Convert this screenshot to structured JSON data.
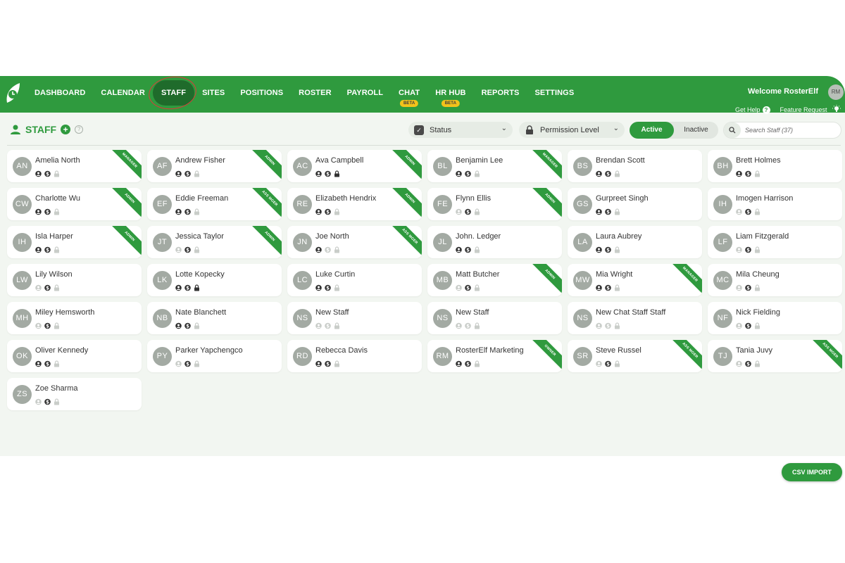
{
  "nav": {
    "items": [
      {
        "label": "DASHBOARD"
      },
      {
        "label": "CALENDAR"
      },
      {
        "label": "STAFF",
        "active": true
      },
      {
        "label": "SITES"
      },
      {
        "label": "POSITIONS"
      },
      {
        "label": "ROSTER"
      },
      {
        "label": "PAYROLL"
      },
      {
        "label": "CHAT",
        "badge": "BETA"
      },
      {
        "label": "HR HUB",
        "badge": "BETA"
      },
      {
        "label": "REPORTS"
      },
      {
        "label": "SETTINGS"
      }
    ],
    "welcome": "Welcome RosterElf",
    "user_initials": "RM",
    "get_help": "Get Help",
    "feature_request": "Feature Request"
  },
  "toolbar": {
    "title": "STAFF",
    "status_select": "Status",
    "permission_select": "Permission Level",
    "active_label": "Active",
    "inactive_label": "Inactive",
    "search_placeholder": "Search Staff (37)"
  },
  "staff": [
    {
      "initials": "AN",
      "name": "Amelia North",
      "ribbon": "MANAGER",
      "icons": [
        "dark",
        "dark",
        "light"
      ]
    },
    {
      "initials": "AF",
      "name": "Andrew Fisher",
      "ribbon": "ADMIN",
      "icons": [
        "dark",
        "dark",
        "light"
      ]
    },
    {
      "initials": "AC",
      "name": "Ava Campbell",
      "ribbon": "ADMIN",
      "icons": [
        "dark",
        "dark",
        "dark"
      ]
    },
    {
      "initials": "BL",
      "name": "Benjamin Lee",
      "ribbon": "MANAGER",
      "icons": [
        "dark",
        "dark",
        "light"
      ]
    },
    {
      "initials": "BS",
      "name": "Brendan Scott",
      "ribbon": "",
      "icons": [
        "dark",
        "dark",
        "light"
      ]
    },
    {
      "initials": "BH",
      "name": "Brett Holmes",
      "ribbon": "",
      "icons": [
        "dark",
        "dark",
        "light"
      ]
    },
    {
      "initials": "CW",
      "name": "Charlotte Wu",
      "ribbon": "ADMIN",
      "icons": [
        "dark",
        "dark",
        "light"
      ]
    },
    {
      "initials": "EF",
      "name": "Eddie Freeman",
      "ribbon": "ASS MGER",
      "icons": [
        "dark",
        "dark",
        "light"
      ]
    },
    {
      "initials": "RE",
      "name": "Elizabeth Hendrix",
      "ribbon": "ADMIN",
      "icons": [
        "dark",
        "dark",
        "light"
      ]
    },
    {
      "initials": "FE",
      "name": "Flynn Ellis",
      "ribbon": "ADMIN",
      "icons": [
        "light",
        "dark",
        "light"
      ]
    },
    {
      "initials": "GS",
      "name": "Gurpreet Singh",
      "ribbon": "",
      "icons": [
        "dark",
        "dark",
        "light"
      ]
    },
    {
      "initials": "IH",
      "name": "Imogen Harrison",
      "ribbon": "",
      "icons": [
        "light",
        "dark",
        "light"
      ]
    },
    {
      "initials": "IH",
      "name": "Isla Harper",
      "ribbon": "ADMIN",
      "icons": [
        "dark",
        "dark",
        "light"
      ]
    },
    {
      "initials": "JT",
      "name": "Jessica Taylor",
      "ribbon": "ADMIN",
      "icons": [
        "light",
        "dark",
        "light"
      ]
    },
    {
      "initials": "JN",
      "name": "Joe North",
      "ribbon": "ASS MGER",
      "icons": [
        "dark",
        "light",
        "light"
      ]
    },
    {
      "initials": "JL",
      "name": "John. Ledger",
      "ribbon": "",
      "icons": [
        "dark",
        "dark",
        "light"
      ]
    },
    {
      "initials": "LA",
      "name": "Laura Aubrey",
      "ribbon": "",
      "icons": [
        "dark",
        "dark",
        "light"
      ]
    },
    {
      "initials": "LF",
      "name": "Liam Fitzgerald",
      "ribbon": "",
      "icons": [
        "light",
        "dark",
        "light"
      ]
    },
    {
      "initials": "LW",
      "name": "Lily Wilson",
      "ribbon": "",
      "icons": [
        "light",
        "dark",
        "light"
      ]
    },
    {
      "initials": "LK",
      "name": "Lotte Kopecky",
      "ribbon": "",
      "icons": [
        "dark",
        "dark",
        "dark"
      ]
    },
    {
      "initials": "LC",
      "name": "Luke Curtin",
      "ribbon": "",
      "icons": [
        "dark",
        "dark",
        "light"
      ]
    },
    {
      "initials": "MB",
      "name": "Matt Butcher",
      "ribbon": "ADMIN",
      "icons": [
        "light",
        "dark",
        "light"
      ]
    },
    {
      "initials": "MW",
      "name": "Mia Wright",
      "ribbon": "MANAGER",
      "icons": [
        "dark",
        "dark",
        "light"
      ]
    },
    {
      "initials": "MC",
      "name": "Mila Cheung",
      "ribbon": "",
      "icons": [
        "light",
        "dark",
        "light"
      ]
    },
    {
      "initials": "MH",
      "name": "Miley Hemsworth",
      "ribbon": "",
      "icons": [
        "light",
        "dark",
        "light"
      ]
    },
    {
      "initials": "NB",
      "name": "Nate Blanchett",
      "ribbon": "",
      "icons": [
        "dark",
        "dark",
        "light"
      ]
    },
    {
      "initials": "NS",
      "name": "New Staff",
      "ribbon": "",
      "icons": [
        "light",
        "light",
        "light"
      ]
    },
    {
      "initials": "NS",
      "name": "New Staff",
      "ribbon": "",
      "icons": [
        "light",
        "light",
        "light"
      ]
    },
    {
      "initials": "NS",
      "name": "New Chat Staff Staff",
      "ribbon": "",
      "icons": [
        "light",
        "light",
        "light"
      ]
    },
    {
      "initials": "NF",
      "name": "Nick Fielding",
      "ribbon": "",
      "icons": [
        "light",
        "dark",
        "light"
      ]
    },
    {
      "initials": "OK",
      "name": "Oliver Kennedy",
      "ribbon": "",
      "icons": [
        "dark",
        "dark",
        "light"
      ]
    },
    {
      "initials": "PY",
      "name": "Parker Yapchengco",
      "ribbon": "",
      "icons": [
        "light",
        "dark",
        "light"
      ]
    },
    {
      "initials": "RD",
      "name": "Rebecca Davis",
      "ribbon": "",
      "icons": [
        "dark",
        "dark",
        "light"
      ]
    },
    {
      "initials": "RM",
      "name": "RosterElf Marketing",
      "ribbon": "OWNER",
      "icons": [
        "dark",
        "dark",
        "light"
      ]
    },
    {
      "initials": "SR",
      "name": "Steve Russel",
      "ribbon": "ASS MGER",
      "icons": [
        "light",
        "dark",
        "light"
      ]
    },
    {
      "initials": "TJ",
      "name": "Tania Juvy",
      "ribbon": "ASS MGER",
      "icons": [
        "light",
        "dark",
        "light"
      ]
    },
    {
      "initials": "ZS",
      "name": "Zoe Sharma",
      "ribbon": "",
      "icons": [
        "light",
        "dark",
        "light"
      ]
    }
  ],
  "footer": {
    "csv_import": "CSV IMPORT"
  },
  "colors": {
    "brand_green": "#2f9a3e",
    "active_nav": "#1f6b2b",
    "beta_badge": "#f2c21b"
  }
}
